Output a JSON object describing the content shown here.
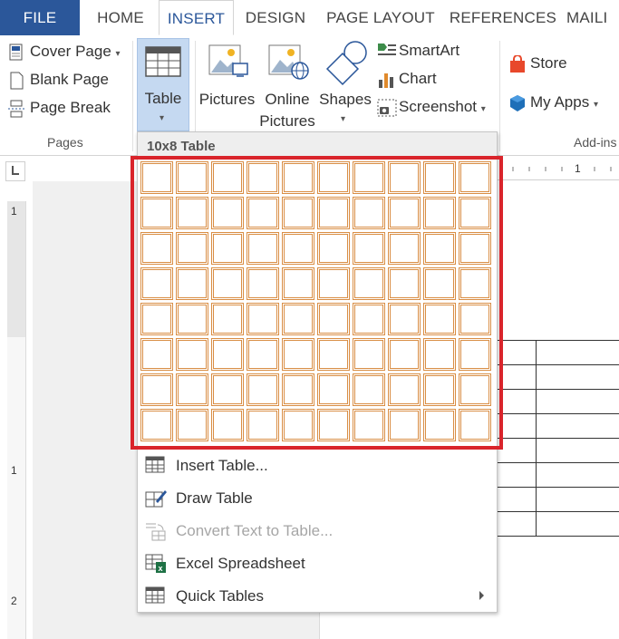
{
  "tabs": [
    {
      "label": "FILE"
    },
    {
      "label": "HOME"
    },
    {
      "label": "INSERT",
      "active": true
    },
    {
      "label": "DESIGN"
    },
    {
      "label": "PAGE LAYOUT"
    },
    {
      "label": "REFERENCES"
    },
    {
      "label": "MAILI"
    }
  ],
  "ribbon": {
    "pages_group": {
      "label": "Pages",
      "cover_page": "Cover Page",
      "blank_page": "Blank Page",
      "page_break": "Page Break"
    },
    "table": {
      "label": "Table"
    },
    "illustrations": {
      "pictures": "Pictures",
      "online_pictures_line1": "Online",
      "online_pictures_line2": "Pictures",
      "shapes": "Shapes",
      "smartart": "SmartArt",
      "chart": "Chart",
      "screenshot": "Screenshot"
    },
    "addins": {
      "store": "Store",
      "my_apps": "My Apps",
      "label": "Add-ins"
    }
  },
  "ruler": {
    "h_mark": "1",
    "v_marks": [
      "1",
      "1",
      "2"
    ]
  },
  "dropdown": {
    "header": "10x8 Table",
    "grid": {
      "columns": 10,
      "rows": 8,
      "highlighted": true
    },
    "menu": [
      {
        "label": "Insert Table...",
        "icon": "insert-table-icon",
        "enabled": true
      },
      {
        "label": "Draw Table",
        "icon": "draw-table-icon",
        "enabled": true
      },
      {
        "label": "Convert Text to Table...",
        "icon": "convert-text-icon",
        "enabled": false
      },
      {
        "label": "Excel Spreadsheet",
        "icon": "excel-icon",
        "enabled": true
      },
      {
        "label": "Quick Tables",
        "icon": "quick-tables-icon",
        "enabled": true,
        "submenu": true
      }
    ]
  },
  "colors": {
    "file_tab": "#2b579a",
    "active_tab_text": "#2b579a",
    "grid_cell_border": "#d98e45",
    "highlight_border": "#d9242b",
    "table_button_bg": "#c5d9f1"
  }
}
